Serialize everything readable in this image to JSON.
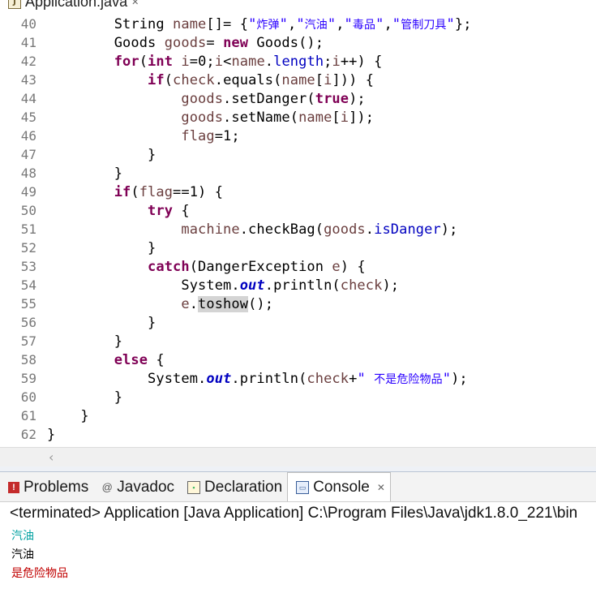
{
  "editor": {
    "tab_label": "Application.java",
    "tab_icon": "java-file-icon",
    "close_glyph": "✕"
  },
  "code_lines": [
    {
      "num": "40",
      "indent": 8,
      "tokens": [
        [
          "plain",
          "String "
        ],
        [
          "var",
          "name"
        ],
        [
          "plain",
          "[]= {"
        ],
        [
          "str",
          "\""
        ],
        [
          "str-cn",
          "炸弹"
        ],
        [
          "str",
          "\""
        ],
        [
          "plain",
          ","
        ],
        [
          "str",
          "\""
        ],
        [
          "str-cn",
          "汽油"
        ],
        [
          "str",
          "\""
        ],
        [
          "plain",
          ","
        ],
        [
          "str",
          "\""
        ],
        [
          "str-cn",
          "毒品"
        ],
        [
          "str",
          "\""
        ],
        [
          "plain",
          ","
        ],
        [
          "str",
          "\""
        ],
        [
          "str-cn",
          "管制刀具"
        ],
        [
          "str",
          "\""
        ],
        [
          "plain",
          "};"
        ]
      ]
    },
    {
      "num": "41",
      "indent": 8,
      "tokens": [
        [
          "plain",
          "Goods "
        ],
        [
          "var",
          "goods"
        ],
        [
          "plain",
          "= "
        ],
        [
          "kw",
          "new"
        ],
        [
          "plain",
          " Goods();"
        ]
      ]
    },
    {
      "num": "42",
      "indent": 8,
      "tokens": [
        [
          "kw",
          "for"
        ],
        [
          "plain",
          "("
        ],
        [
          "kw",
          "int"
        ],
        [
          "plain",
          " "
        ],
        [
          "var",
          "i"
        ],
        [
          "plain",
          "=0;"
        ],
        [
          "var",
          "i"
        ],
        [
          "plain",
          "<"
        ],
        [
          "var",
          "name"
        ],
        [
          "plain",
          "."
        ],
        [
          "fld",
          "length"
        ],
        [
          "plain",
          ";"
        ],
        [
          "var",
          "i"
        ],
        [
          "plain",
          "++) {"
        ]
      ]
    },
    {
      "num": "43",
      "indent": 12,
      "tokens": [
        [
          "kw",
          "if"
        ],
        [
          "plain",
          "("
        ],
        [
          "var",
          "check"
        ],
        [
          "plain",
          ".equals("
        ],
        [
          "var",
          "name"
        ],
        [
          "plain",
          "["
        ],
        [
          "var",
          "i"
        ],
        [
          "plain",
          "])) {"
        ]
      ]
    },
    {
      "num": "44",
      "indent": 16,
      "tokens": [
        [
          "var",
          "goods"
        ],
        [
          "plain",
          ".setDanger("
        ],
        [
          "kw",
          "true"
        ],
        [
          "plain",
          ");"
        ]
      ]
    },
    {
      "num": "45",
      "indent": 16,
      "tokens": [
        [
          "var",
          "goods"
        ],
        [
          "plain",
          ".setName("
        ],
        [
          "var",
          "name"
        ],
        [
          "plain",
          "["
        ],
        [
          "var",
          "i"
        ],
        [
          "plain",
          "]);"
        ]
      ]
    },
    {
      "num": "46",
      "indent": 16,
      "tokens": [
        [
          "var",
          "flag"
        ],
        [
          "plain",
          "=1;"
        ]
      ]
    },
    {
      "num": "47",
      "indent": 12,
      "tokens": [
        [
          "plain",
          "}"
        ]
      ]
    },
    {
      "num": "48",
      "indent": 8,
      "tokens": [
        [
          "plain",
          "}"
        ]
      ]
    },
    {
      "num": "49",
      "indent": 8,
      "tokens": [
        [
          "kw",
          "if"
        ],
        [
          "plain",
          "("
        ],
        [
          "var",
          "flag"
        ],
        [
          "plain",
          "==1) {"
        ]
      ]
    },
    {
      "num": "50",
      "indent": 12,
      "tokens": [
        [
          "kw",
          "try"
        ],
        [
          "plain",
          " {"
        ]
      ]
    },
    {
      "num": "51",
      "indent": 16,
      "tokens": [
        [
          "var",
          "machine"
        ],
        [
          "plain",
          ".checkBag("
        ],
        [
          "var",
          "goods"
        ],
        [
          "plain",
          "."
        ],
        [
          "fld",
          "isDanger"
        ],
        [
          "plain",
          ");"
        ]
      ]
    },
    {
      "num": "52",
      "indent": 12,
      "tokens": [
        [
          "plain",
          "}"
        ]
      ]
    },
    {
      "num": "53",
      "indent": 12,
      "tokens": [
        [
          "kw",
          "catch"
        ],
        [
          "plain",
          "(DangerException "
        ],
        [
          "var",
          "e"
        ],
        [
          "plain",
          ") {"
        ]
      ]
    },
    {
      "num": "54",
      "indent": 16,
      "tokens": [
        [
          "plain",
          "System."
        ],
        [
          "sfld",
          "out"
        ],
        [
          "plain",
          ".println("
        ],
        [
          "var",
          "check"
        ],
        [
          "plain",
          ");"
        ]
      ]
    },
    {
      "num": "55",
      "indent": 16,
      "tokens": [
        [
          "var",
          "e"
        ],
        [
          "plain",
          "."
        ],
        [
          "hl",
          "toshow"
        ],
        [
          "plain",
          "();"
        ]
      ]
    },
    {
      "num": "56",
      "indent": 12,
      "tokens": [
        [
          "plain",
          "}"
        ]
      ]
    },
    {
      "num": "57",
      "indent": 8,
      "tokens": [
        [
          "plain",
          "}"
        ]
      ]
    },
    {
      "num": "58",
      "indent": 8,
      "tokens": [
        [
          "kw",
          "else"
        ],
        [
          "plain",
          " {"
        ]
      ]
    },
    {
      "num": "59",
      "indent": 12,
      "tokens": [
        [
          "plain",
          "System."
        ],
        [
          "sfld",
          "out"
        ],
        [
          "plain",
          ".println("
        ],
        [
          "var",
          "check"
        ],
        [
          "plain",
          "+"
        ],
        [
          "str",
          "\" "
        ],
        [
          "str-cn",
          "不是危险物品"
        ],
        [
          "str",
          "\""
        ],
        [
          "plain",
          ");"
        ]
      ]
    },
    {
      "num": "60",
      "indent": 8,
      "tokens": [
        [
          "plain",
          "}"
        ]
      ]
    },
    {
      "num": "61",
      "indent": 4,
      "tokens": [
        [
          "plain",
          "}"
        ]
      ]
    },
    {
      "num": "62",
      "indent": 0,
      "tokens": [
        [
          "plain",
          "}"
        ]
      ]
    }
  ],
  "views": {
    "tabs": [
      {
        "label": "Problems",
        "icon": "problems-icon",
        "active": false
      },
      {
        "label": "Javadoc",
        "icon": "javadoc-icon",
        "active": false
      },
      {
        "label": "Declaration",
        "icon": "declaration-icon",
        "active": false
      },
      {
        "label": "Console",
        "icon": "console-icon",
        "active": true
      }
    ],
    "console_header": "<terminated> Application [Java Application] C:\\Program Files\\Java\\jdk1.8.0_221\\bin",
    "output": [
      {
        "text": "汽油",
        "color": "#00a0a0"
      },
      {
        "text": "汽油",
        "color": "#000000"
      },
      {
        "text": "是危险物品",
        "color": "#c00000"
      }
    ]
  }
}
